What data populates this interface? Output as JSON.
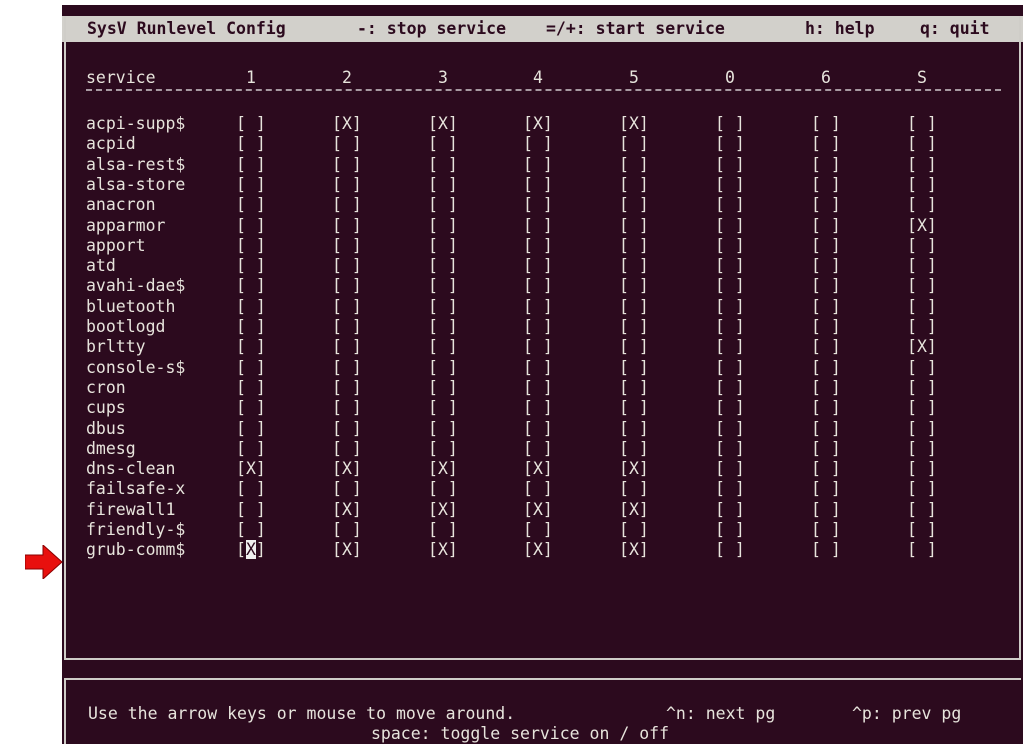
{
  "window": {
    "title": "SysV Runlevel Config",
    "hint_stop": "-: stop service",
    "hint_start": "=/+: start service",
    "hint_help": "h: help",
    "hint_quit": "q: quit"
  },
  "table": {
    "header_service": "service",
    "runlevels": [
      "1",
      "2",
      "3",
      "4",
      "5",
      "0",
      "6",
      "S"
    ],
    "rows": [
      {
        "name": "acpi-supp$",
        "states": [
          " ",
          "X",
          "X",
          "X",
          "X",
          " ",
          " ",
          " "
        ]
      },
      {
        "name": "acpid",
        "states": [
          " ",
          " ",
          " ",
          " ",
          " ",
          " ",
          " ",
          " "
        ]
      },
      {
        "name": "alsa-rest$",
        "states": [
          " ",
          " ",
          " ",
          " ",
          " ",
          " ",
          " ",
          " "
        ]
      },
      {
        "name": "alsa-store",
        "states": [
          " ",
          " ",
          " ",
          " ",
          " ",
          " ",
          " ",
          " "
        ]
      },
      {
        "name": "anacron",
        "states": [
          " ",
          " ",
          " ",
          " ",
          " ",
          " ",
          " ",
          " "
        ]
      },
      {
        "name": "apparmor",
        "states": [
          " ",
          " ",
          " ",
          " ",
          " ",
          " ",
          " ",
          "X"
        ]
      },
      {
        "name": "apport",
        "states": [
          " ",
          " ",
          " ",
          " ",
          " ",
          " ",
          " ",
          " "
        ]
      },
      {
        "name": "atd",
        "states": [
          " ",
          " ",
          " ",
          " ",
          " ",
          " ",
          " ",
          " "
        ]
      },
      {
        "name": "avahi-dae$",
        "states": [
          " ",
          " ",
          " ",
          " ",
          " ",
          " ",
          " ",
          " "
        ]
      },
      {
        "name": "bluetooth",
        "states": [
          " ",
          " ",
          " ",
          " ",
          " ",
          " ",
          " ",
          " "
        ]
      },
      {
        "name": "bootlogd",
        "states": [
          " ",
          " ",
          " ",
          " ",
          " ",
          " ",
          " ",
          " "
        ]
      },
      {
        "name": "brltty",
        "states": [
          " ",
          " ",
          " ",
          " ",
          " ",
          " ",
          " ",
          "X"
        ]
      },
      {
        "name": "console-s$",
        "states": [
          " ",
          " ",
          " ",
          " ",
          " ",
          " ",
          " ",
          " "
        ]
      },
      {
        "name": "cron",
        "states": [
          " ",
          " ",
          " ",
          " ",
          " ",
          " ",
          " ",
          " "
        ]
      },
      {
        "name": "cups",
        "states": [
          " ",
          " ",
          " ",
          " ",
          " ",
          " ",
          " ",
          " "
        ]
      },
      {
        "name": "dbus",
        "states": [
          " ",
          " ",
          " ",
          " ",
          " ",
          " ",
          " ",
          " "
        ]
      },
      {
        "name": "dmesg",
        "states": [
          " ",
          " ",
          " ",
          " ",
          " ",
          " ",
          " ",
          " "
        ]
      },
      {
        "name": "dns-clean",
        "states": [
          "X",
          "X",
          "X",
          "X",
          "X",
          " ",
          " ",
          " "
        ]
      },
      {
        "name": "failsafe-x",
        "states": [
          " ",
          " ",
          " ",
          " ",
          " ",
          " ",
          " ",
          " "
        ]
      },
      {
        "name": "firewall1",
        "states": [
          " ",
          "X",
          "X",
          "X",
          "X",
          " ",
          " ",
          " "
        ]
      },
      {
        "name": "friendly-$",
        "states": [
          " ",
          " ",
          " ",
          " ",
          " ",
          " ",
          " ",
          " "
        ]
      },
      {
        "name": "grub-comm$",
        "states": [
          "X",
          "X",
          "X",
          "X",
          "X",
          " ",
          " ",
          " "
        ]
      }
    ],
    "cursor": {
      "row": 21,
      "col": 0
    }
  },
  "footer": {
    "line1_move": "Use the arrow keys or mouse to move around.",
    "line1_next": "^n: next pg",
    "line1_prev": "^p: prev pg",
    "line2": "space: toggle service on / off"
  },
  "annotation": {
    "arrow_color": "#e8100e",
    "points_to": "firewall1"
  }
}
